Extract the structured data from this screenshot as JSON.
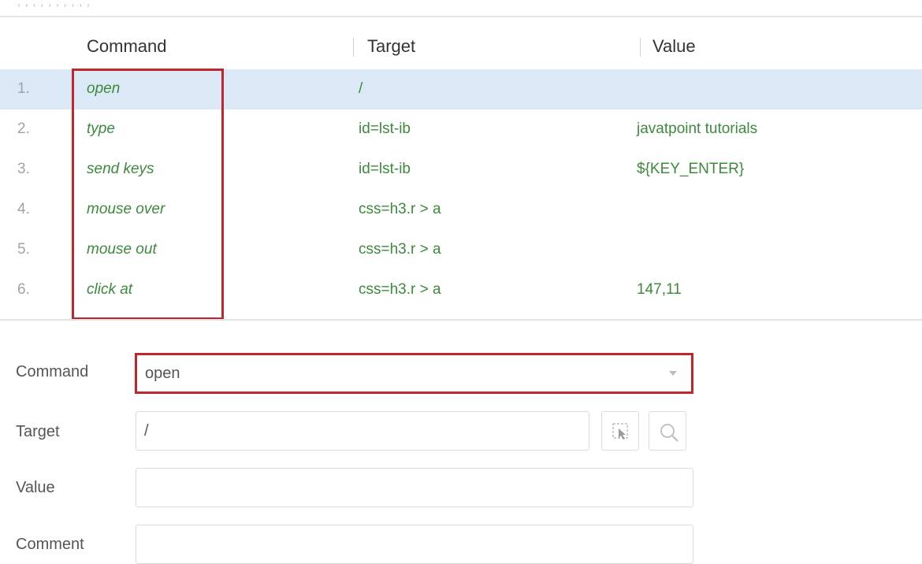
{
  "table": {
    "headers": {
      "command": "Command",
      "target": "Target",
      "value": "Value"
    },
    "rows": [
      {
        "num": "1.",
        "command": "open",
        "target": "/",
        "value": ""
      },
      {
        "num": "2.",
        "command": "type",
        "target": "id=lst-ib",
        "value": "javatpoint tutorials"
      },
      {
        "num": "3.",
        "command": "send keys",
        "target": "id=lst-ib",
        "value": "${KEY_ENTER}"
      },
      {
        "num": "4.",
        "command": "mouse over",
        "target": "css=h3.r > a",
        "value": ""
      },
      {
        "num": "5.",
        "command": "mouse out",
        "target": "css=h3.r > a",
        "value": ""
      },
      {
        "num": "6.",
        "command": "click at",
        "target": "css=h3.r > a",
        "value": "147,11"
      }
    ],
    "selected_row": 0
  },
  "form": {
    "command_label": "Command",
    "command_value": "open",
    "target_label": "Target",
    "target_value": "/",
    "value_label": "Value",
    "value_value": "",
    "comment_label": "Comment",
    "comment_value": ""
  },
  "icons": {
    "select_target": "cursor-select-icon",
    "find_target": "search-icon"
  },
  "colors": {
    "highlight_border": "#c0272d",
    "selected_row_bg": "#dbe8f5",
    "command_text": "#3c8a3c"
  }
}
